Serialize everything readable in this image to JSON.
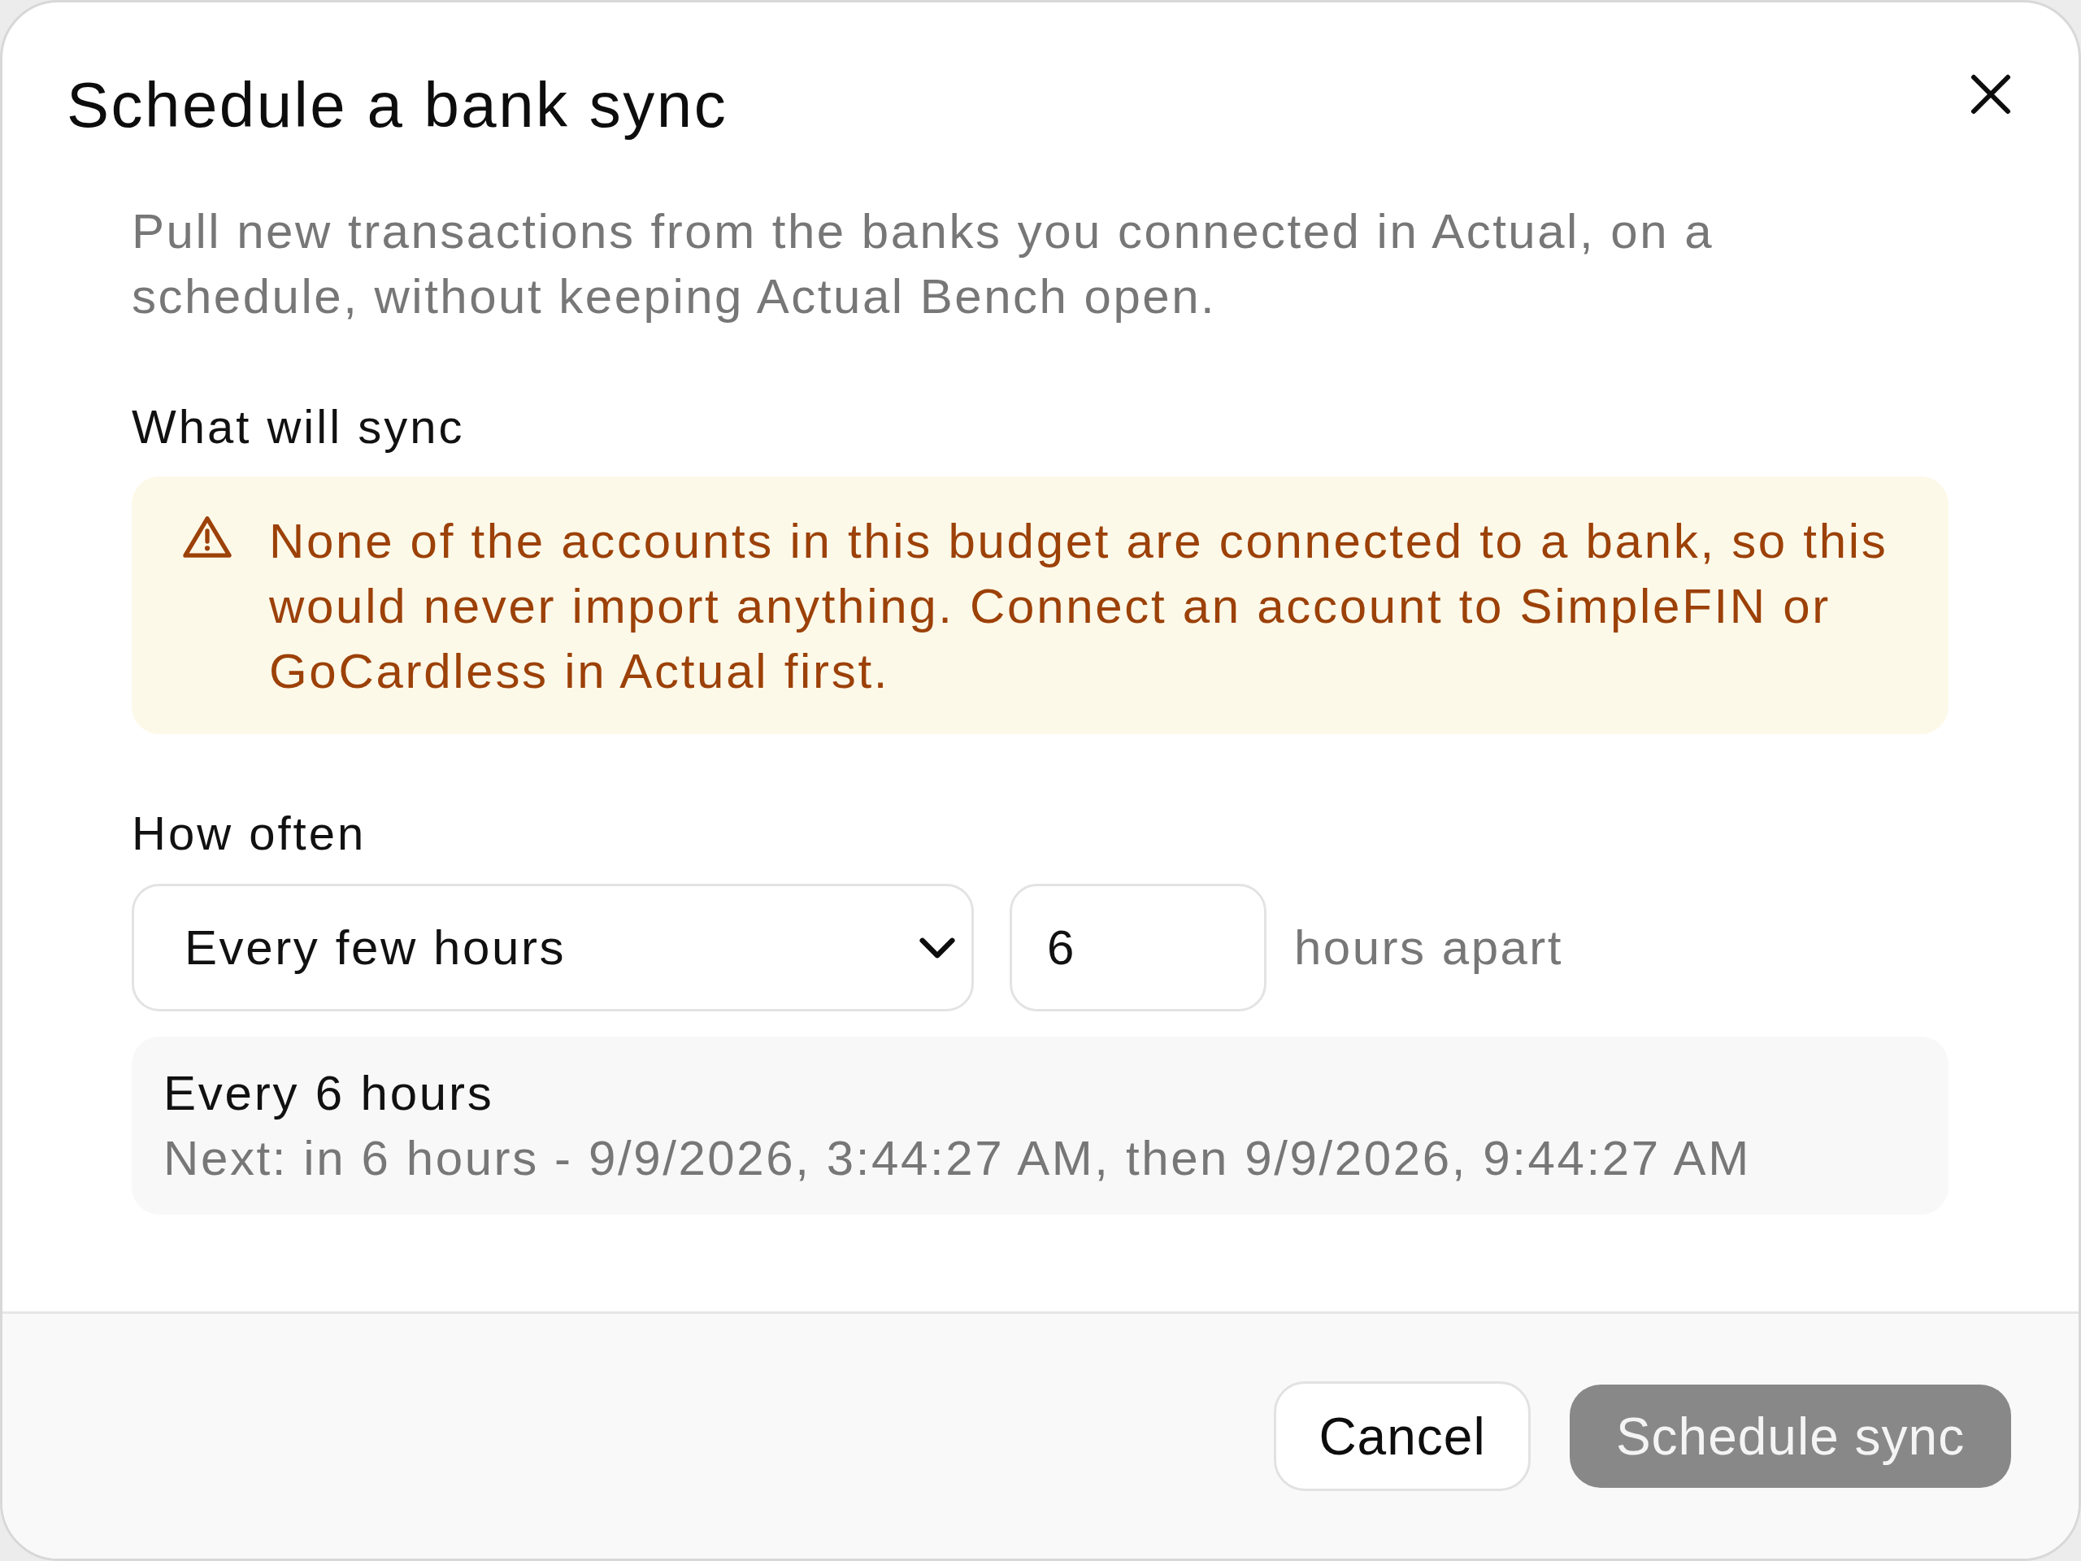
{
  "dialog": {
    "title": "Schedule a bank sync",
    "description": "Pull new transactions from the banks you connected in Actual, on a schedule, without keeping Actual Bench open."
  },
  "what_will_sync": {
    "heading": "What will sync",
    "warning": "None of the accounts in this budget are connected to a bank, so this would never import anything. Connect an account to SimpleFIN or GoCardless in Actual first."
  },
  "how_often": {
    "heading": "How often",
    "frequency_select": {
      "value": "Every few hours"
    },
    "interval_input": {
      "value": "6"
    },
    "unit_label": "hours apart",
    "summary": {
      "title": "Every 6 hours",
      "next": "Next: in 6 hours - 9/9/2026, 3:44:27 AM, then 9/9/2026, 9:44:27 AM"
    }
  },
  "footer": {
    "buttons": [
      {
        "label": "Cancel",
        "kind": "secondary",
        "disabled": false
      },
      {
        "label": "Schedule sync",
        "kind": "primary",
        "disabled": true
      }
    ]
  }
}
